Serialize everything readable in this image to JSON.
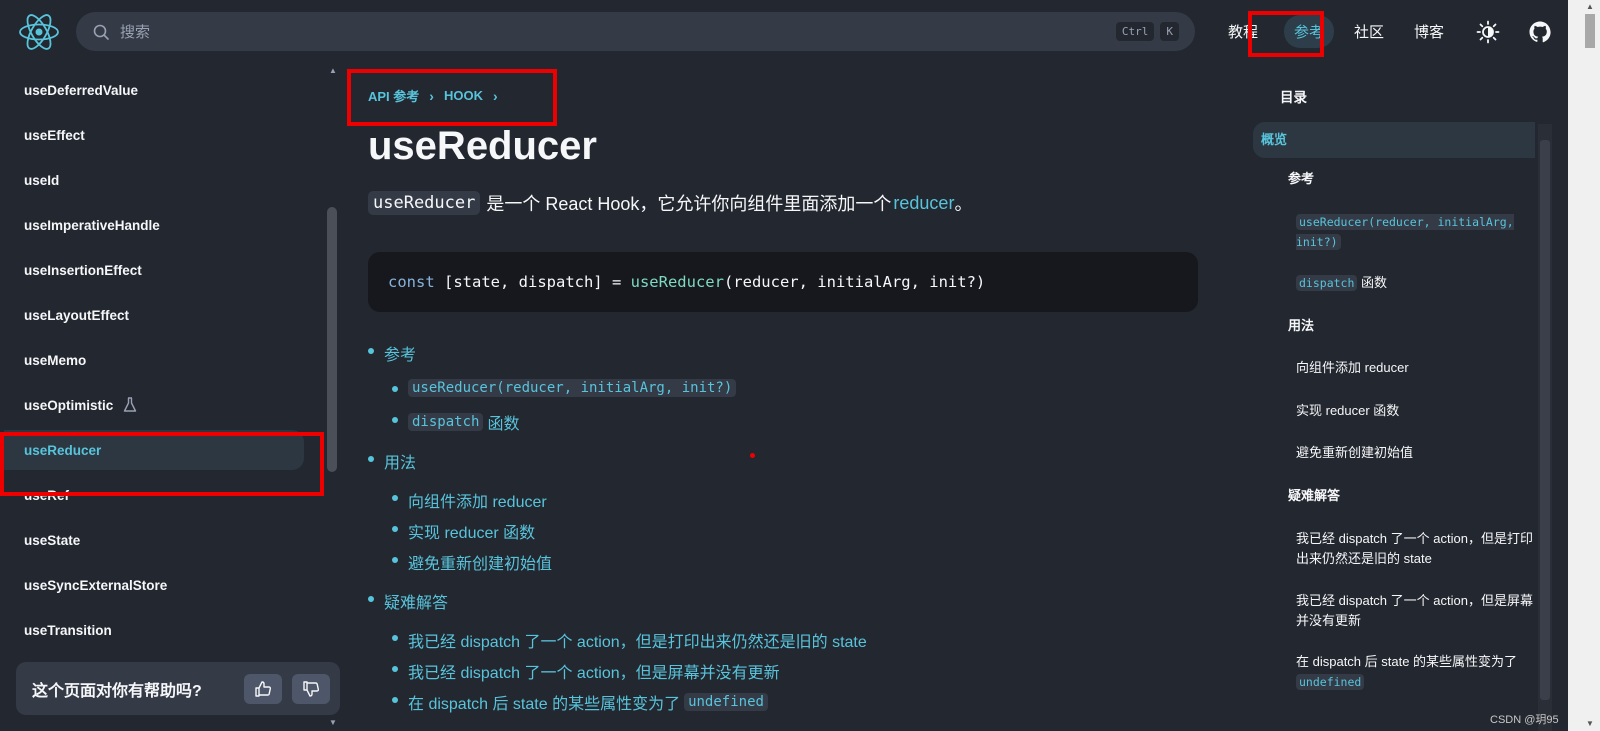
{
  "header": {
    "search_placeholder": "搜索",
    "shortcut_keys": [
      "Ctrl",
      "K"
    ],
    "nav": [
      {
        "label": "教程",
        "active": false
      },
      {
        "label": "参考",
        "active": true
      },
      {
        "label": "社区",
        "active": false
      },
      {
        "label": "博客",
        "active": false
      }
    ],
    "accent_color": "#58c4dc"
  },
  "sidebar": {
    "items": [
      {
        "label": "useDeferredValue"
      },
      {
        "label": "useEffect"
      },
      {
        "label": "useId"
      },
      {
        "label": "useImperativeHandle"
      },
      {
        "label": "useInsertionEffect"
      },
      {
        "label": "useLayoutEffect"
      },
      {
        "label": "useMemo"
      },
      {
        "label": "useOptimistic",
        "experimental": true
      },
      {
        "label": "useReducer",
        "active": true
      },
      {
        "label": "useRef"
      },
      {
        "label": "useState"
      },
      {
        "label": "useSyncExternalStore"
      },
      {
        "label": "useTransition"
      }
    ],
    "feedback_question": "这个页面对你有帮助吗?"
  },
  "main": {
    "breadcrumbs": [
      "API 参考",
      "HOOK"
    ],
    "title": "useReducer",
    "intro_code": "useReducer",
    "intro_text": "是一个 React Hook，它允许你向组件里面添加一个",
    "intro_link": "reducer",
    "intro_end": "。",
    "code": {
      "kw": "const",
      "left": " [state, dispatch] = ",
      "fn": "useReducer",
      "args": "(reducer, initialArg, init?)"
    },
    "toc": {
      "ref": "参考",
      "ref_sig": "useReducer(reducer, initialArg, init?)",
      "dispatch_code": "dispatch",
      "dispatch_text": "函数",
      "usage": "用法",
      "usage_1": "向组件添加 reducer",
      "usage_2": "实现 reducer 函数",
      "usage_3": "避免重新创建初始值",
      "trouble": "疑难解答",
      "trouble_1": "我已经 dispatch 了一个 action，但是打印出来仍然还是旧的 state",
      "trouble_2": "我已经 dispatch 了一个 action，但是屏幕并没有更新",
      "trouble_3": "在 dispatch 后 state 的某些属性变为了",
      "trouble_3_code": "undefined"
    }
  },
  "right_toc": {
    "heading": "目录",
    "overview": "概览",
    "ref": "参考",
    "ref_sig": "useReducer(reducer, initialArg, init?)",
    "dispatch_code": "dispatch",
    "dispatch_text": "函数",
    "usage": "用法",
    "usage_1": "向组件添加 reducer",
    "usage_2": "实现 reducer 函数",
    "usage_3": "避免重新创建初始值",
    "trouble": "疑难解答",
    "trouble_1": "我已经 dispatch 了一个 action，但是打印出来仍然还是旧的 state",
    "trouble_2": "我已经 dispatch 了一个 action，但是屏幕并没有更新",
    "trouble_3": "在 dispatch 后 state 的某些属性变为了",
    "trouble_3_code": "undefined"
  },
  "watermark": "CSDN @玥95"
}
